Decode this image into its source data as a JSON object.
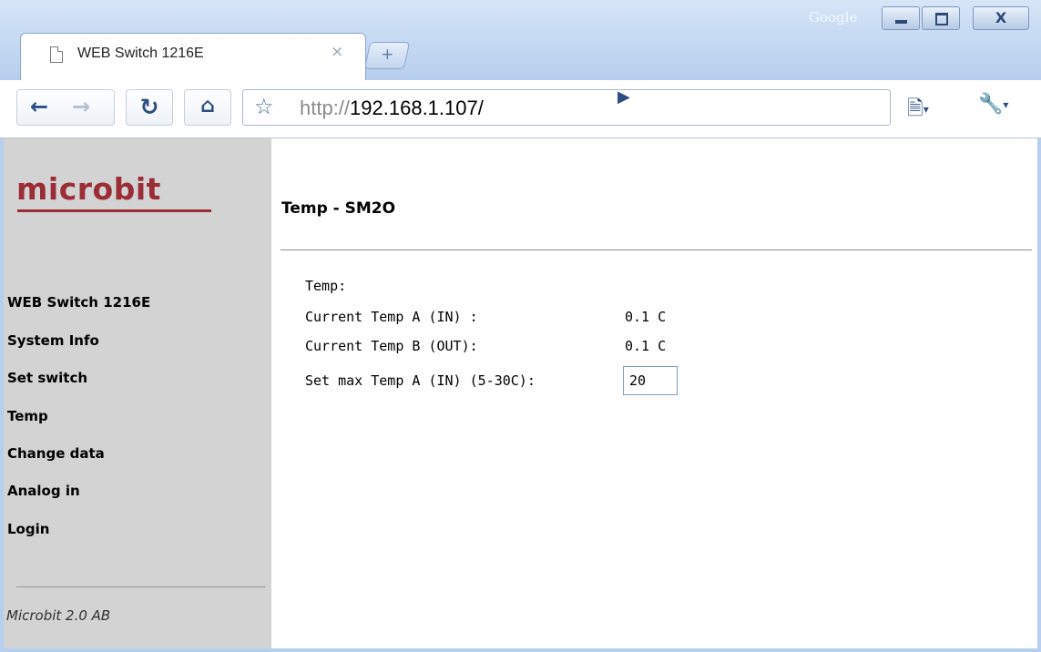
{
  "browser": {
    "brand": "Google",
    "tab_title": "WEB Switch 1216E",
    "tab_close": "×",
    "new_tab": "+",
    "url_scheme": "http://",
    "url_rest": "192.168.1.107/",
    "close_glyph": "X"
  },
  "sidebar": {
    "logo": "microbit",
    "items": [
      {
        "label": "WEB Switch 1216E"
      },
      {
        "label": "System Info"
      },
      {
        "label": "Set switch"
      },
      {
        "label": "Temp"
      },
      {
        "label": "Change data"
      },
      {
        "label": "Analog in"
      },
      {
        "label": "Login"
      }
    ],
    "footer": "Microbit 2.0 AB"
  },
  "main": {
    "title": "Temp - SM2O",
    "heading": "Temp:",
    "rows": [
      {
        "label": "Current Temp A (IN) :",
        "value": "0.1 C"
      },
      {
        "label": "Current Temp B (OUT):",
        "value": "0.1 C"
      }
    ],
    "max_label": "Set max Temp A (IN) (5-30C):",
    "max_value": "20"
  },
  "colors": {
    "logo": "#9b2d36",
    "sidebar_bg": "#d3d3d3",
    "frame": "#b7cfee"
  }
}
